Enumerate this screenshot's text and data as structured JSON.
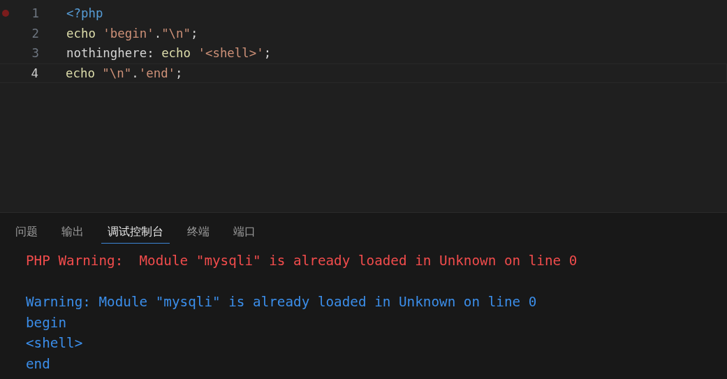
{
  "editor": {
    "lines": [
      {
        "number": "1",
        "breakpoint": true,
        "current": false,
        "tokens": [
          {
            "text": "<?php",
            "kind": "tag"
          }
        ]
      },
      {
        "number": "2",
        "breakpoint": false,
        "current": false,
        "tokens": [
          {
            "text": "echo ",
            "kind": "keyword"
          },
          {
            "text": "'begin'",
            "kind": "string"
          },
          {
            "text": ".",
            "kind": "plain"
          },
          {
            "text": "\"\\n\"",
            "kind": "string"
          },
          {
            "text": ";",
            "kind": "plain"
          }
        ]
      },
      {
        "number": "3",
        "breakpoint": false,
        "current": false,
        "tokens": [
          {
            "text": "nothinghere: ",
            "kind": "plain"
          },
          {
            "text": "echo ",
            "kind": "keyword"
          },
          {
            "text": "'<shell>'",
            "kind": "string"
          },
          {
            "text": ";",
            "kind": "plain"
          }
        ]
      },
      {
        "number": "4",
        "breakpoint": false,
        "current": true,
        "tokens": [
          {
            "text": "echo ",
            "kind": "keyword"
          },
          {
            "text": "\"\\n\"",
            "kind": "string"
          },
          {
            "text": ".",
            "kind": "plain"
          },
          {
            "text": "'end'",
            "kind": "string"
          },
          {
            "text": ";",
            "kind": "plain"
          }
        ]
      }
    ]
  },
  "panel": {
    "tabs": [
      {
        "label": "问题",
        "selected": false
      },
      {
        "label": "输出",
        "selected": false
      },
      {
        "label": "调试控制台",
        "selected": true
      },
      {
        "label": "终端",
        "selected": false
      },
      {
        "label": "端口",
        "selected": false
      }
    ],
    "console": [
      {
        "text": "PHP Warning:  Module \"mysqli\" is already loaded in Unknown on line 0",
        "kind": "stderr",
        "gap_before": false
      },
      {
        "text": "Warning: Module \"mysqli\" is already loaded in Unknown on line 0",
        "kind": "stdout",
        "gap_before": true
      },
      {
        "text": "begin",
        "kind": "stdout",
        "gap_before": false
      },
      {
        "text": "<shell>",
        "kind": "stdout",
        "gap_before": false
      },
      {
        "text": "end",
        "kind": "stdout",
        "gap_before": false
      }
    ]
  }
}
